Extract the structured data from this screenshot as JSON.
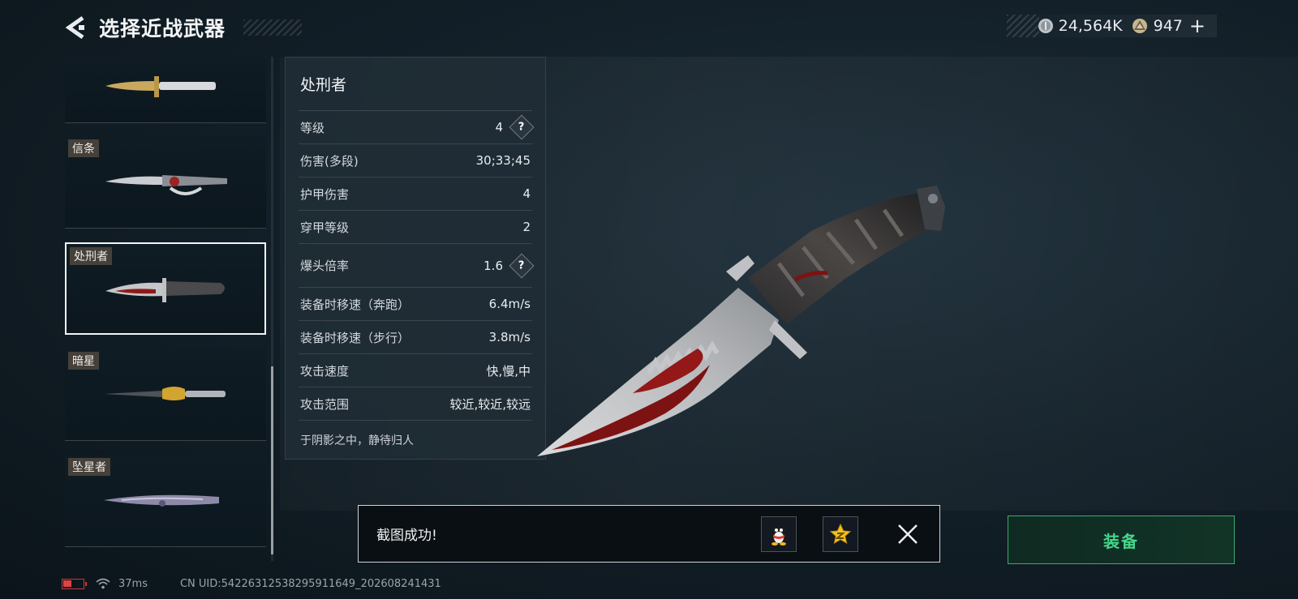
{
  "header": {
    "title": "选择近战武器",
    "currency": [
      {
        "icon": "silver-coin-icon",
        "amount": "24,564K"
      },
      {
        "icon": "triangle-coin-icon",
        "amount": "947"
      }
    ],
    "plus": "+"
  },
  "weapon_list": [
    {
      "tag": "",
      "color": "#c9a85e"
    },
    {
      "tag": "信条",
      "color": "#b8bcc2"
    },
    {
      "tag": "处刑者",
      "color": "#9a2020",
      "selected": true
    },
    {
      "tag": "暗星",
      "color": "#d2a530"
    },
    {
      "tag": "坠星者",
      "color": "#8d8aa8"
    }
  ],
  "stats": {
    "name": "处刑者",
    "rows": [
      {
        "label": "等级",
        "value": "4",
        "help": true
      },
      {
        "label": "伤害(多段)",
        "value": "30;33;45"
      },
      {
        "label": "护甲伤害",
        "value": "4"
      },
      {
        "label": "穿甲等级",
        "value": "2"
      },
      {
        "label": "爆头倍率",
        "value": "1.6",
        "help": true
      },
      {
        "label": "装备时移速（奔跑）",
        "value": "6.4m/s"
      },
      {
        "label": "装备时移速（步行）",
        "value": "3.8m/s"
      },
      {
        "label": "攻击速度",
        "value": "快,慢,中"
      },
      {
        "label": "攻击范围",
        "value": "较近,较近,较远"
      }
    ],
    "help_mark": "?",
    "flavor": "于阴影之中，静待归人"
  },
  "toast": {
    "text": "截图成功!",
    "share": [
      "qq-penguin-icon",
      "qzone-star-icon"
    ]
  },
  "equip_label": "装备",
  "status_bar": {
    "ping": "37ms",
    "uid": "CN UID:54226312538295911649_202608241431"
  },
  "colors": {
    "accent_green": "#45d68a",
    "battery_red": "#e04141"
  }
}
